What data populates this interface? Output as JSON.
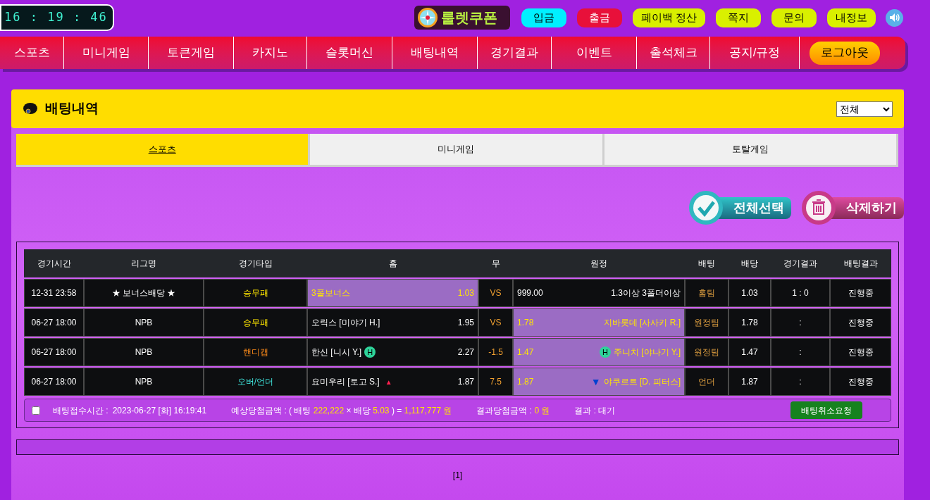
{
  "header": {
    "clock": "16 : 19 : 46",
    "logo": "룰렛쿠폰",
    "buttons": [
      {
        "label": "입금",
        "color": "#00f0ff"
      },
      {
        "label": "출금",
        "color": "#e8103a"
      },
      {
        "label": "페이백 정산",
        "color": "#d9f000"
      },
      {
        "label": "쪽지",
        "color": "#d9f000"
      },
      {
        "label": "문의",
        "color": "#d9f000"
      },
      {
        "label": "내정보",
        "color": "#d9f000"
      }
    ]
  },
  "nav": {
    "items": [
      "스포츠",
      "미니게임",
      "토큰게임",
      "카지노",
      "슬롯머신",
      "배팅내역",
      "경기결과",
      "이벤트",
      "출석체크",
      "공지/규정"
    ],
    "logout": "로그아웃"
  },
  "section": {
    "title": "배팅내역",
    "filter": "전체"
  },
  "tabs": [
    {
      "label": "스포츠",
      "selected": true
    },
    {
      "label": "미니게임",
      "selected": false
    },
    {
      "label": "토탈게임",
      "selected": false
    }
  ],
  "actions": [
    "전체선택",
    "삭제하기"
  ],
  "table": {
    "columns": [
      "경기시간",
      "리그명",
      "경기타입",
      "홈",
      "무",
      "원정",
      "배팅",
      "배당",
      "경기결과",
      "배팅결과"
    ],
    "rows": [
      {
        "time": "12-31 23:58",
        "league": "★ 보너스배당 ★",
        "type": {
          "kind": "win_draw_lose",
          "label": "승무패"
        },
        "home": {
          "name": "3폴보너스",
          "odds": "1.03",
          "selected": true
        },
        "draw": "VS",
        "away": {
          "odds": "999.00",
          "name": "1.3이상 3폴더이상",
          "selected": false
        },
        "bet": "홈팀",
        "odds": "1.03",
        "result": "1 : 0",
        "status": "진행중"
      },
      {
        "time": "06-27 18:00",
        "league": "NPB",
        "type": {
          "kind": "win_draw_lose",
          "label": "승무패"
        },
        "home": {
          "name": "오릭스 [미야기 H.]",
          "odds": "1.95",
          "selected": false
        },
        "draw": "VS",
        "away": {
          "odds": "1.78",
          "name": "지바롯데 [사사키 R.]",
          "selected": true
        },
        "bet": "원정팀",
        "odds": "1.78",
        "result": ":",
        "status": "진행중"
      },
      {
        "time": "06-27 18:00",
        "league": "NPB",
        "type": {
          "kind": "handicap",
          "label": "핸디캡"
        },
        "home": {
          "name": "한신 [니시 Y.]",
          "mark": {
            "kind": "badge",
            "text": "H"
          },
          "odds": "2.27",
          "selected": false
        },
        "draw": "-1.5",
        "away": {
          "odds": "1.47",
          "mark": {
            "kind": "badge",
            "text": "H"
          },
          "name": "주니치 [야나기 Y.]",
          "selected": true
        },
        "bet": "원정팀",
        "odds": "1.47",
        "result": ":",
        "status": "진행중"
      },
      {
        "time": "06-27 18:00",
        "league": "NPB",
        "type": {
          "kind": "over_under",
          "label": "오버/언더"
        },
        "home": {
          "name": "요미우리 [토고 S.]",
          "mark": {
            "kind": "up",
            "text": "▲"
          },
          "odds": "1.87",
          "selected": false
        },
        "draw": "7.5",
        "away": {
          "odds": "1.87",
          "mark": {
            "kind": "down",
            "text": "▼"
          },
          "name": "야쿠르트 [D. 피터스]",
          "selected": true
        },
        "bet": "언더",
        "odds": "1.87",
        "result": ":",
        "status": "진행중"
      }
    ]
  },
  "summary": {
    "checked": false,
    "received_label": "배팅접수시간 :",
    "received": "2023-06-27 [화] 16:19:41",
    "expected": [
      {
        "text": "예상당첨금액 : ( 배팅 ",
        "highlight": false
      },
      {
        "text": "222,222",
        "highlight": true
      },
      {
        "text": " × 배당 ",
        "highlight": false
      },
      {
        "text": "5.03",
        "highlight": true
      },
      {
        "text": " ) = ",
        "highlight": false
      },
      {
        "text": "1,117,777 원",
        "highlight": true
      }
    ],
    "won": [
      {
        "text": "결과당첨금액 : ",
        "highlight": false
      },
      {
        "text": "0 원",
        "highlight": true
      }
    ],
    "result": "결과 : 대기",
    "cancel": "배팅취소요청"
  },
  "pagination": "[1]"
}
